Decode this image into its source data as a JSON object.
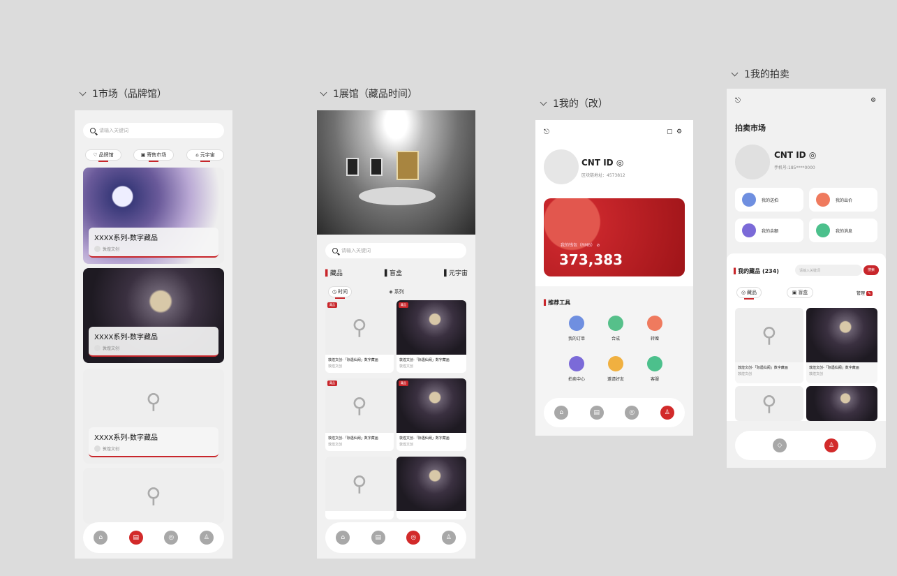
{
  "frames": {
    "market": {
      "title": "1市场（品牌馆）",
      "search_placeholder": "请输入关键词",
      "tabs": [
        "品牌馆",
        "寄售市场",
        "元宇宙"
      ],
      "cards": [
        {
          "title": "XXXX系列-数字藏品",
          "sub": "敦煌文创"
        },
        {
          "title": "XXXX系列-数字藏品",
          "sub": "敦煌文创"
        },
        {
          "title": "XXXX系列-数字藏品",
          "sub": "敦煌文创"
        }
      ]
    },
    "gallery": {
      "title": "1展馆（藏品时间）",
      "search_placeholder": "请输入关键词",
      "categories": [
        "藏品",
        "盲盒",
        "元宇宙"
      ],
      "filters": [
        "时间",
        "系列"
      ],
      "items": [
        {
          "title": "敦煌文创-「际遇仙阙」数字藏画",
          "sub": "敦煌文创",
          "tag": "藏品",
          "code": "MKB456ME"
        },
        {
          "title": "敦煌文创-「际遇仙阙」数字藏画",
          "sub": "敦煌文创",
          "tag": "藏品",
          "code": "MKB456ME"
        },
        {
          "title": "敦煌文创-「际遇仙阙」数字藏画",
          "sub": "敦煌文创",
          "tag": "藏品",
          "code": "MKB456ME"
        },
        {
          "title": "敦煌文创-「际遇仙阙」数字藏画",
          "sub": "敦煌文创",
          "tag": "藏品",
          "code": "MKB456ME"
        }
      ]
    },
    "mine": {
      "title": "1我的（改）",
      "user_name": "CNT ID",
      "chain_address": "区块链地址：4573812",
      "wallet_label": "我的钱包（RMB）",
      "wallet_amount": "373,383",
      "tools_title": "推荐工具",
      "tools": [
        {
          "label": "我的订单",
          "color": "#6f8fe0"
        },
        {
          "label": "合成",
          "color": "#56c08a"
        },
        {
          "label": "转赠",
          "color": "#ef7a5e"
        },
        {
          "label": "拍卖中心",
          "color": "#7b6ad8"
        },
        {
          "label": "邀请好友",
          "color": "#f0b040"
        },
        {
          "label": "客服",
          "color": "#4cc08c"
        }
      ]
    },
    "auction": {
      "title": "1我的拍卖",
      "market_title": "拍卖市场",
      "user_name": "CNT ID",
      "phone": "手机号:185****0000",
      "tiles": [
        {
          "label": "我的送拍",
          "color": "#6f8fe0"
        },
        {
          "label": "我的出价",
          "color": "#ef7a5e"
        },
        {
          "label": "我的余额",
          "color": "#7b6ad8"
        },
        {
          "label": "我的消息",
          "color": "#4cc08c"
        }
      ],
      "collection_title": "我的藏品 (234)",
      "search_placeholder": "请输入关键词",
      "search_button": "搜索",
      "tabs": [
        "藏品",
        "盲盒"
      ],
      "manage_label": "管理",
      "items": [
        {
          "title": "敦煌文创-「际遇仙阙」数字藏画",
          "sub": "敦煌文创"
        },
        {
          "title": "敦煌文创-「际遇仙阙」数字藏画",
          "sub": "敦煌文创"
        }
      ]
    }
  }
}
